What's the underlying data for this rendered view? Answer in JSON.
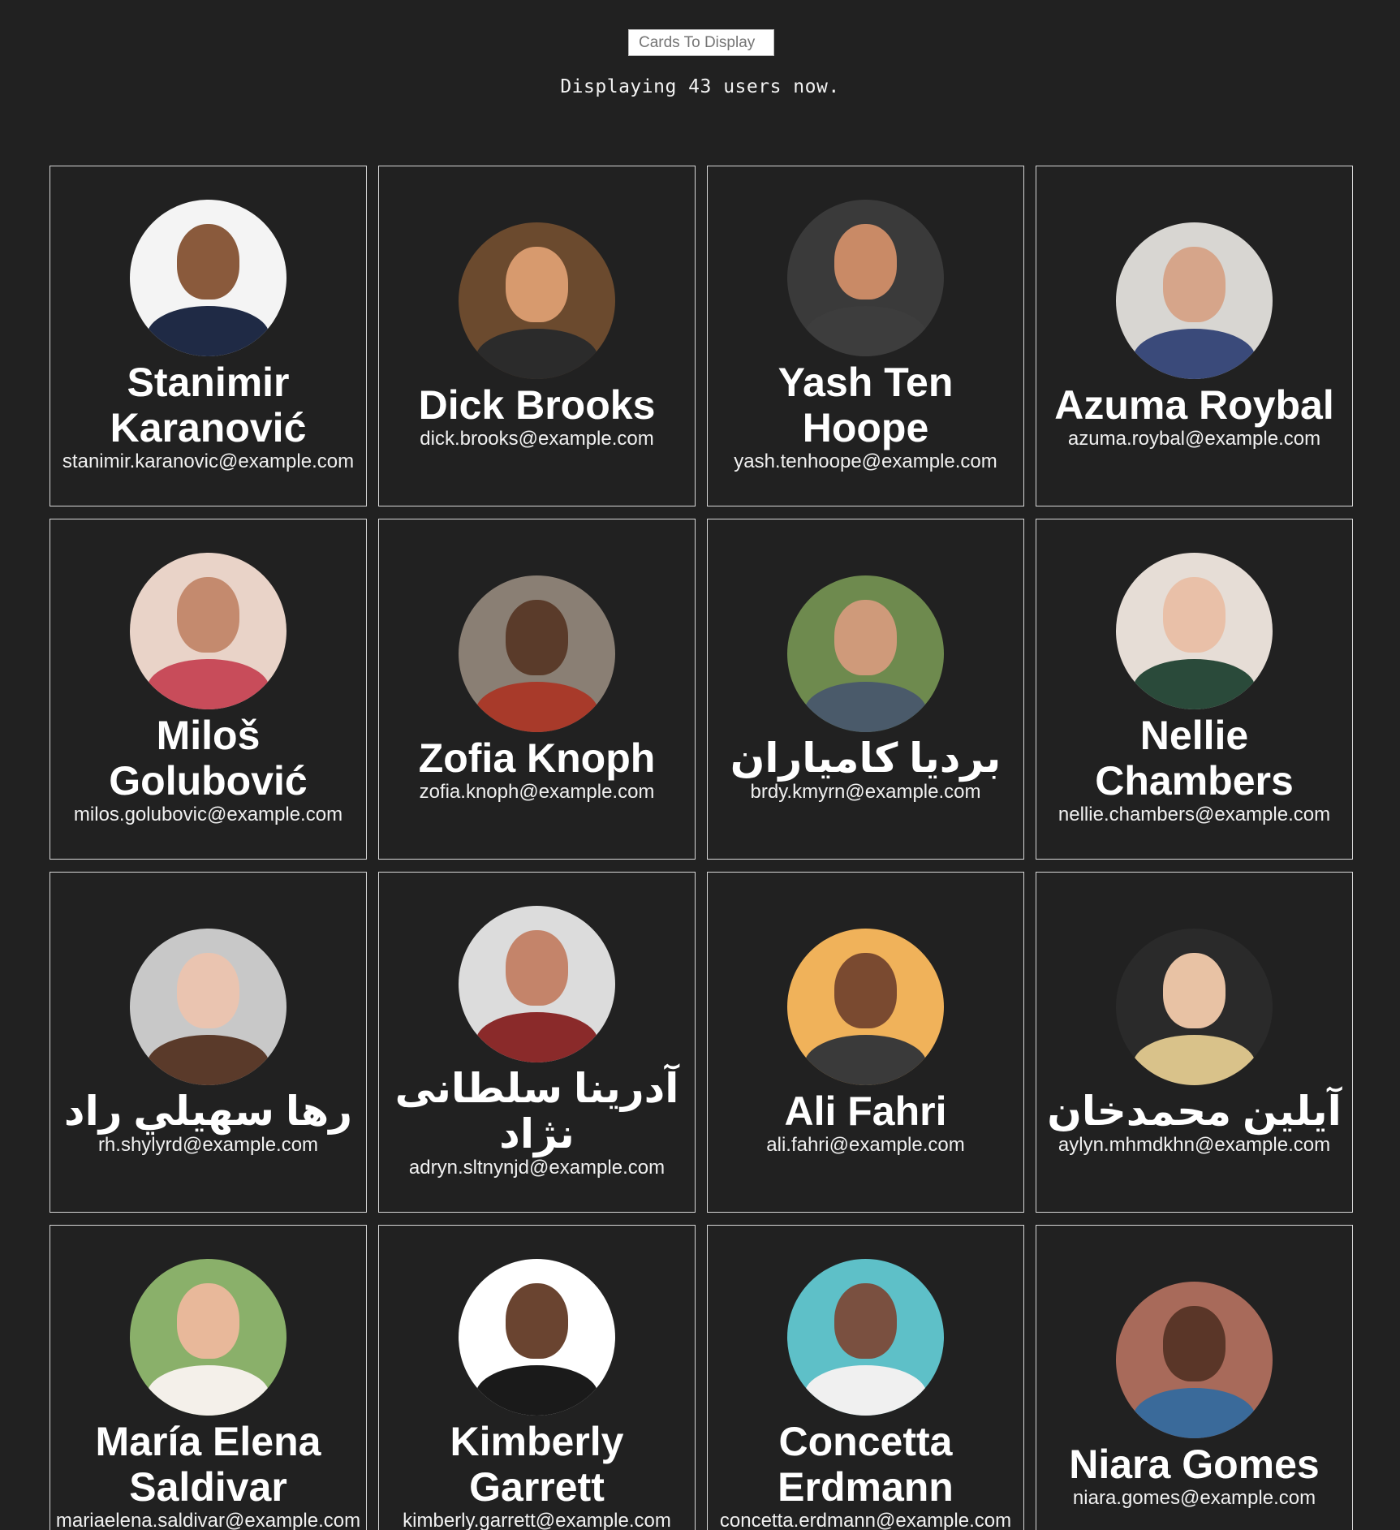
{
  "header": {
    "cards_input_placeholder": "Cards To Display",
    "status_text": "Displaying 43 users now."
  },
  "cards": [
    {
      "name": "Stanimir Karanović",
      "email": "stanimir.karanovic@example.com",
      "avatar_colors": {
        "bg": "#f4f4f4",
        "skin": "#8a5a3c",
        "clothes": "#1f2a45"
      }
    },
    {
      "name": "Dick Brooks",
      "email": "dick.brooks@example.com",
      "avatar_colors": {
        "bg": "#6b4a2e",
        "skin": "#d79a6e",
        "clothes": "#2b2b2b"
      }
    },
    {
      "name": "Yash Ten Hoope",
      "email": "yash.tenhoope@example.com",
      "avatar_colors": {
        "bg": "#3a3a3a",
        "skin": "#c98a66",
        "clothes": "#3d3d3d"
      }
    },
    {
      "name": "Azuma Roybal",
      "email": "azuma.roybal@example.com",
      "avatar_colors": {
        "bg": "#d8d6d2",
        "skin": "#d6a58a",
        "clothes": "#3a4a7a"
      }
    },
    {
      "name": "Miloš Golubović",
      "email": "milos.golubovic@example.com",
      "avatar_colors": {
        "bg": "#e9d3c8",
        "skin": "#c48a6e",
        "clothes": "#c84c5a"
      }
    },
    {
      "name": "Zofia Knoph",
      "email": "zofia.knoph@example.com",
      "avatar_colors": {
        "bg": "#8a7f74",
        "skin": "#5a3b2a",
        "clothes": "#a83a2a"
      }
    },
    {
      "name": "بردیا کامیاران",
      "email": "brdy.kmyrn@example.com",
      "avatar_colors": {
        "bg": "#6e8a4e",
        "skin": "#cf9a7a",
        "clothes": "#4a5a6a"
      }
    },
    {
      "name": "Nellie Chambers",
      "email": "nellie.chambers@example.com",
      "avatar_colors": {
        "bg": "#e6ddd6",
        "skin": "#e9c0a8",
        "clothes": "#2a4a3a"
      }
    },
    {
      "name": "رها سهيلي راد",
      "email": "rh.shylyrd@example.com",
      "avatar_colors": {
        "bg": "#c8c8c8",
        "skin": "#eac4b0",
        "clothes": "#5a3a2a"
      }
    },
    {
      "name": "آدرينا سلطانی نژاد",
      "email": "adryn.sltnynjd@example.com",
      "avatar_colors": {
        "bg": "#dcdcdc",
        "skin": "#c4846a",
        "clothes": "#8a2a2a"
      }
    },
    {
      "name": "Ali Fahri",
      "email": "ali.fahri@example.com",
      "avatar_colors": {
        "bg": "#f0b25a",
        "skin": "#7a4a30",
        "clothes": "#3a3a3a"
      }
    },
    {
      "name": "آیلین محمدخان",
      "email": "aylyn.mhmdkhn@example.com",
      "avatar_colors": {
        "bg": "#2a2a2a",
        "skin": "#e8c2a4",
        "clothes": "#d9c28a"
      }
    },
    {
      "name": "María Elena Saldivar",
      "email": "mariaelena.saldivar@example.com",
      "avatar_colors": {
        "bg": "#8ab06a",
        "skin": "#e8b89a",
        "clothes": "#f4f0ea"
      }
    },
    {
      "name": "Kimberly Garrett",
      "email": "kimberly.garrett@example.com",
      "avatar_colors": {
        "bg": "#ffffff",
        "skin": "#6a4430",
        "clothes": "#1a1a1a"
      }
    },
    {
      "name": "Concetta Erdmann",
      "email": "concetta.erdmann@example.com",
      "avatar_colors": {
        "bg": "#5ec0c8",
        "skin": "#7a5040",
        "clothes": "#f0f0f0"
      }
    },
    {
      "name": "Niara Gomes",
      "email": "niara.gomes@example.com",
      "avatar_colors": {
        "bg": "#a86a5a",
        "skin": "#5a3628",
        "clothes": "#3a6a9a"
      }
    }
  ]
}
